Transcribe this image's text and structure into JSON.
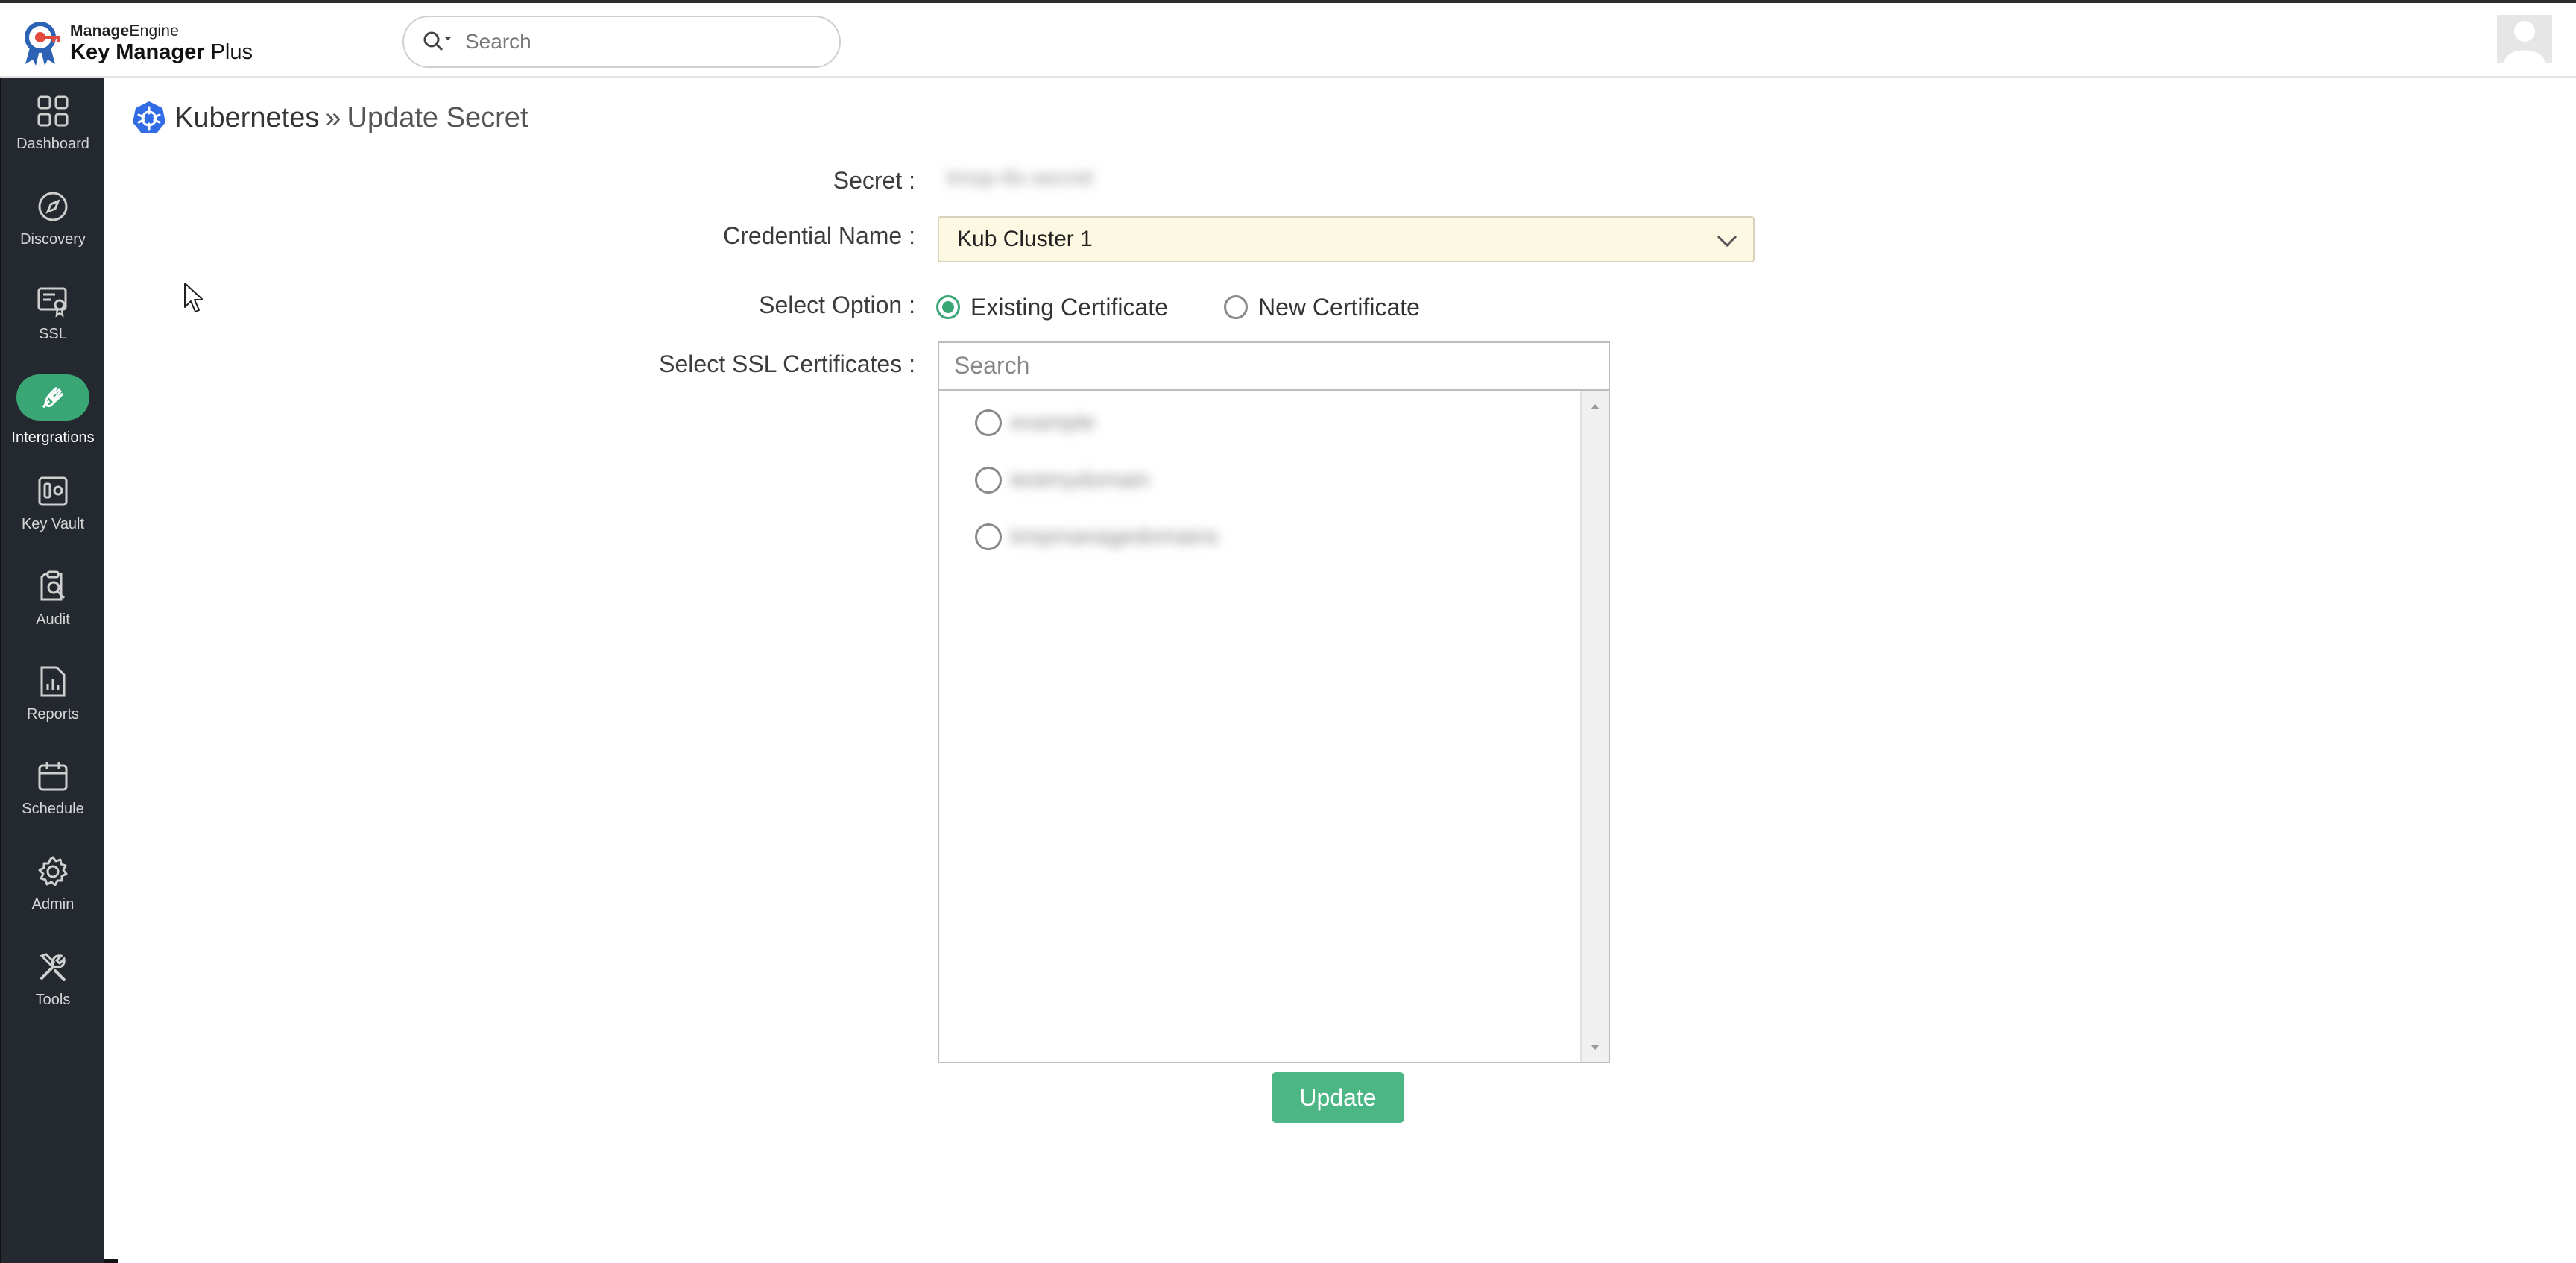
{
  "header": {
    "brand_bold": "Manage",
    "brand_rest": "Engine",
    "product_bold": "Key Manager",
    "product_rest": " Plus",
    "search_placeholder": "Search",
    "logo_icon": "key-ribbon-logo-icon",
    "avatar_icon": "user-avatar-icon"
  },
  "sidebar": {
    "items": [
      {
        "label": "Dashboard",
        "icon": "grid-icon"
      },
      {
        "label": "Discovery",
        "icon": "compass-icon"
      },
      {
        "label": "SSL",
        "icon": "certificate-icon"
      },
      {
        "label": "Intergrations",
        "icon": "plug-icon",
        "active": true
      },
      {
        "label": "Key Vault",
        "icon": "vault-icon"
      },
      {
        "label": "Audit",
        "icon": "audit-icon"
      },
      {
        "label": "Reports",
        "icon": "report-icon"
      },
      {
        "label": "Schedule",
        "icon": "calendar-icon"
      },
      {
        "label": "Admin",
        "icon": "gear-icon"
      },
      {
        "label": "Tools",
        "icon": "tools-icon"
      }
    ],
    "active_color": "#3aa675"
  },
  "page": {
    "breadcrumb_main": "Kubernetes",
    "breadcrumb_sep": "»",
    "breadcrumb_sub": "Update Secret"
  },
  "form": {
    "secret_label": "Secret :",
    "secret_value": "tmsp-tls-secret",
    "credential_label": "Credential Name :",
    "credential_value": "Kub Cluster 1",
    "option_label": "Select Option :",
    "options": [
      {
        "label": "Existing Certificate",
        "checked": true
      },
      {
        "label": "New Certificate",
        "checked": false
      }
    ],
    "ssl_label": "Select SSL Certificates :",
    "ssl_search_placeholder": "Search",
    "certificates": [
      {
        "name": "example"
      },
      {
        "name": "testmydomain"
      },
      {
        "name": "kmpmanagedomains"
      }
    ],
    "update_label": "Update"
  },
  "colors": {
    "accent": "#3aa675",
    "button": "#4cb684",
    "select_bg": "#fdf8e2",
    "sidebar_bg": "#24292f"
  }
}
